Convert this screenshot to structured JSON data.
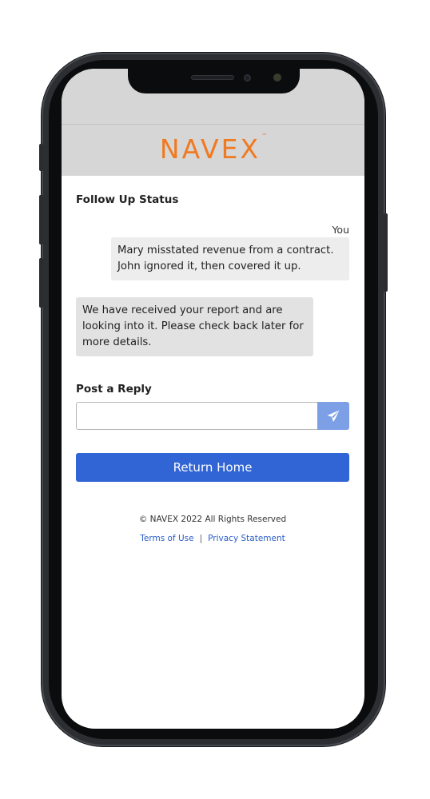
{
  "brand": {
    "logo_text": "NAVEX",
    "trademark": "™",
    "logo_color": "#f07a22"
  },
  "follow_up": {
    "title": "Follow Up Status",
    "sender_label": "You",
    "messages": [
      {
        "from": "user",
        "text": "Mary misstated revenue from a contract. John ignored it, then covered it up."
      },
      {
        "from": "staff",
        "text": "We have received your report and are looking into it. Please check back later for more details."
      }
    ]
  },
  "reply": {
    "title": "Post a Reply",
    "value": "",
    "placeholder": "",
    "send_icon": "paper-plane-icon"
  },
  "actions": {
    "return_home_label": "Return Home",
    "primary_color": "#3164d5"
  },
  "footer": {
    "copyright": "© NAVEX 2022  All Rights Reserved",
    "terms_label": "Terms of Use",
    "separator": "|",
    "privacy_label": "Privacy Statement"
  }
}
